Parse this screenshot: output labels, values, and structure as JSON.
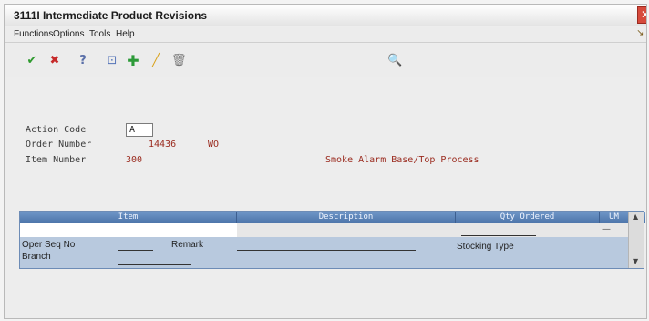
{
  "window": {
    "title": "3111I  Intermediate Product Revisions"
  },
  "menu": {
    "items": [
      "Functions",
      "Options",
      "Tools",
      "Help"
    ]
  },
  "form": {
    "action_code_label": "Action Code",
    "action_code_value": "A",
    "order_number_label": "Order Number",
    "order_number_value": "14436",
    "order_type_value": "WO",
    "item_number_label": "Item Number",
    "item_number_value": "300",
    "item_description": "Smoke Alarm Base/Top Process"
  },
  "grid": {
    "columns": [
      "Item",
      "Description",
      "Qty Ordered",
      "UM"
    ],
    "detail": {
      "oper_seq_label": "Oper Seq No",
      "branch_label": "Branch",
      "remark_label": "Remark",
      "stocking_type_label": "Stocking Type"
    }
  },
  "icons": {
    "toolbar": [
      "ok-icon",
      "cancel-icon",
      "help-icon",
      "find-icon",
      "add-icon",
      "edit-icon",
      "delete-icon",
      "search-icon"
    ]
  }
}
